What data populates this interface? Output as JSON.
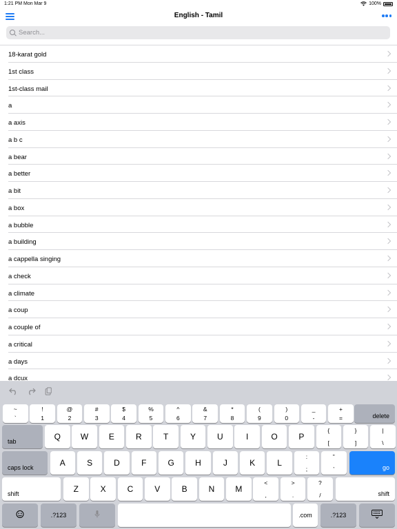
{
  "status": {
    "time": "1:21 PM",
    "date": "Mon Mar 9",
    "battery": "100%"
  },
  "nav": {
    "title": "English - Tamil"
  },
  "search": {
    "placeholder": "Search...",
    "value": ""
  },
  "list": {
    "items": [
      "18-karat gold",
      "1st class",
      "1st-class mail",
      "a",
      "a axis",
      "a b c",
      "a bear",
      "a better",
      "a bit",
      "a box",
      "a bubble",
      "a building",
      "a cappella singing",
      "a check",
      "a climate",
      "a coup",
      "a couple of",
      "a critical",
      "a days",
      "a dcux"
    ]
  },
  "keyboard": {
    "toolbar_icons": [
      "undo-icon",
      "redo-icon",
      "paste-icon"
    ],
    "number_row": [
      {
        "top": "~",
        "bot": "`"
      },
      {
        "top": "!",
        "bot": "1"
      },
      {
        "top": "@",
        "bot": "2"
      },
      {
        "top": "#",
        "bot": "3"
      },
      {
        "top": "$",
        "bot": "4"
      },
      {
        "top": "%",
        "bot": "5"
      },
      {
        "top": "^",
        "bot": "6"
      },
      {
        "top": "&",
        "bot": "7"
      },
      {
        "top": "*",
        "bot": "8"
      },
      {
        "top": "(",
        "bot": "9"
      },
      {
        "top": ")",
        "bot": "0"
      },
      {
        "top": "_",
        "bot": "-"
      },
      {
        "top": "+",
        "bot": "="
      }
    ],
    "delete": "delete",
    "tab": "tab",
    "row_q": [
      "Q",
      "W",
      "E",
      "R",
      "T",
      "Y",
      "U",
      "I",
      "O",
      "P"
    ],
    "row_q_sym": [
      {
        "top": "{",
        "bot": "["
      },
      {
        "top": "}",
        "bot": "]"
      },
      {
        "top": "|",
        "bot": "\\"
      }
    ],
    "caps_lock": "caps lock",
    "row_a": [
      "A",
      "S",
      "D",
      "F",
      "G",
      "H",
      "J",
      "K",
      "L"
    ],
    "row_a_sym": [
      {
        "top": ":",
        "bot": ";"
      },
      {
        "top": "”",
        "bot": "’"
      }
    ],
    "go": "go",
    "shift": "shift",
    "row_z": [
      "Z",
      "X",
      "C",
      "V",
      "B",
      "N",
      "M"
    ],
    "row_z_sym": [
      {
        "top": "<",
        "bot": ","
      },
      {
        "top": ">",
        "bot": "."
      },
      {
        "top": "?",
        "bot": "/"
      }
    ],
    "numbers_key": ".?123",
    "dotcom": ".com",
    "colors": {
      "go": "#1a82fb",
      "accent": "#1f7cf5"
    }
  }
}
